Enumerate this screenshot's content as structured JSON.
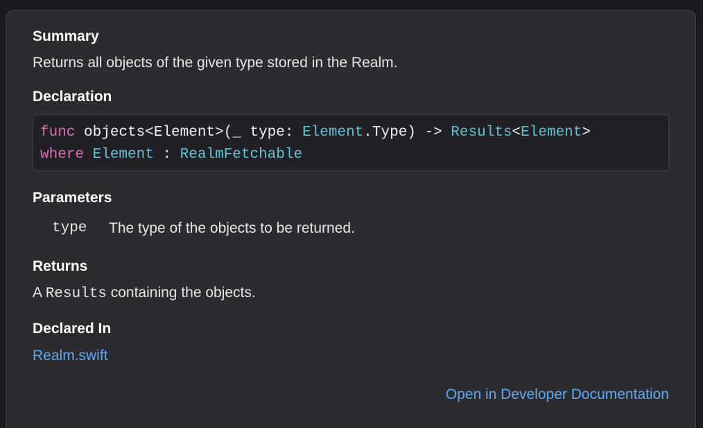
{
  "popover": {
    "summary": {
      "title": "Summary",
      "text": "Returns all objects of the given type stored in the Realm."
    },
    "declaration": {
      "title": "Declaration",
      "line1": {
        "kw_func": "func",
        "name": " objects<Element>(_ type: ",
        "t_element": "Element",
        "dot_type": ".Type) -> ",
        "t_results": "Results",
        "lt": "<",
        "t_element2": "Element",
        "gt": ">"
      },
      "line2": {
        "kw_where": "where",
        "sp1": " ",
        "t_element": "Element",
        "colon": " : ",
        "t_proto": "RealmFetchable"
      }
    },
    "parameters": {
      "title": "Parameters",
      "items": [
        {
          "name": "type",
          "description": "The type of the objects to be returned."
        }
      ]
    },
    "returns": {
      "title": "Returns",
      "prefix": "A ",
      "code": "Results",
      "suffix": " containing the objects."
    },
    "declared_in": {
      "title": "Declared In",
      "file": "Realm.swift"
    },
    "open_docs_label": "Open in Developer Documentation"
  },
  "colors": {
    "background": "#2c2c30",
    "keyword": "#e06bb6",
    "type": "#5fc3d6",
    "link": "#5ba8f5",
    "text": "#e6e6e8"
  }
}
